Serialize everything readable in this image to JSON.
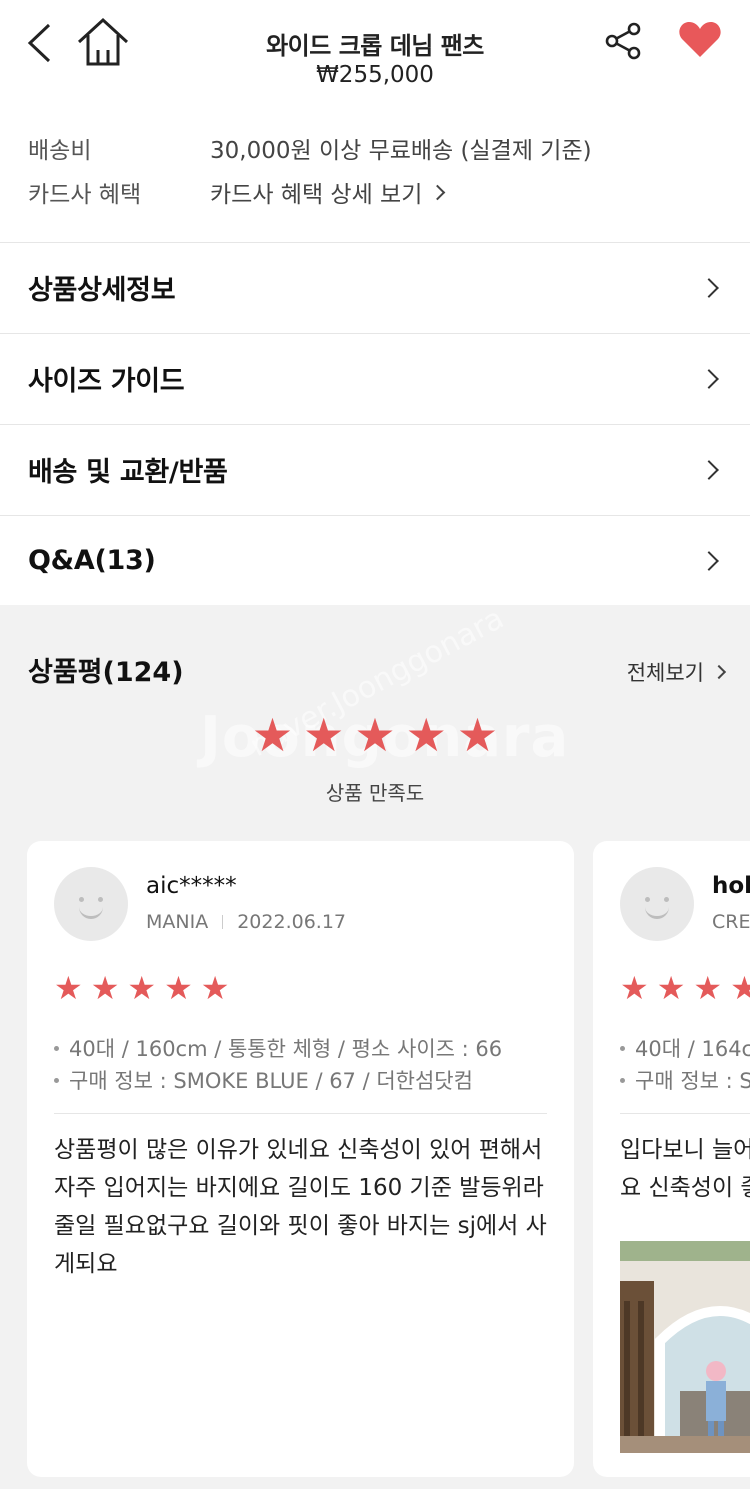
{
  "header": {
    "title": "와이드 크롭 데님 팬츠",
    "price": "₩255,000",
    "icons": [
      "back-icon",
      "home-icon",
      "share-icon",
      "heart-icon"
    ],
    "heart_color": "#e8585a"
  },
  "shipping": {
    "fee_label": "배송비",
    "fee_value": "30,000원 이상 무료배송 (실결제 기준)",
    "card_label": "카드사 혜택",
    "card_value": "카드사 혜택 상세 보기"
  },
  "menu": [
    {
      "label": "상품상세정보"
    },
    {
      "label": "사이즈 가이드"
    },
    {
      "label": "배송 및 교환/반품"
    },
    {
      "label": "Q&A(13)"
    }
  ],
  "reviews": {
    "title": "상품평(124)",
    "view_all": "전체보기",
    "satisfaction_label": "상품 만족도",
    "average_rating": 5,
    "watermark": "Joongonara",
    "watermark_sub": "naver.Joonggonara",
    "star_color": "#e45a5a",
    "items": [
      {
        "user": "aic*****",
        "level": "MANIA",
        "date": "2022.06.17",
        "rating": 5,
        "body_info": "40대 / 160cm / 통통한 체형 / 평소 사이즈 : 66",
        "purchase_info": "구매 정보 : SMOKE BLUE / 67 / 더한섬닷컴",
        "text": "상품평이 많은 이유가 있네요 신축성이 있어 편해서 자주 입어지는 바지에요 길이도 160 기준 발등위라 줄일 필요없구요 길이와 핏이 좋아 바지는 sj에서 사게되요"
      },
      {
        "user": "hoh",
        "level": "CRE",
        "rating": 5,
        "body_info": "40대 / 164c",
        "purchase_info": "구매 정보 : S",
        "text": "입다보니 늘어\n요 신축성이 좋"
      }
    ]
  }
}
